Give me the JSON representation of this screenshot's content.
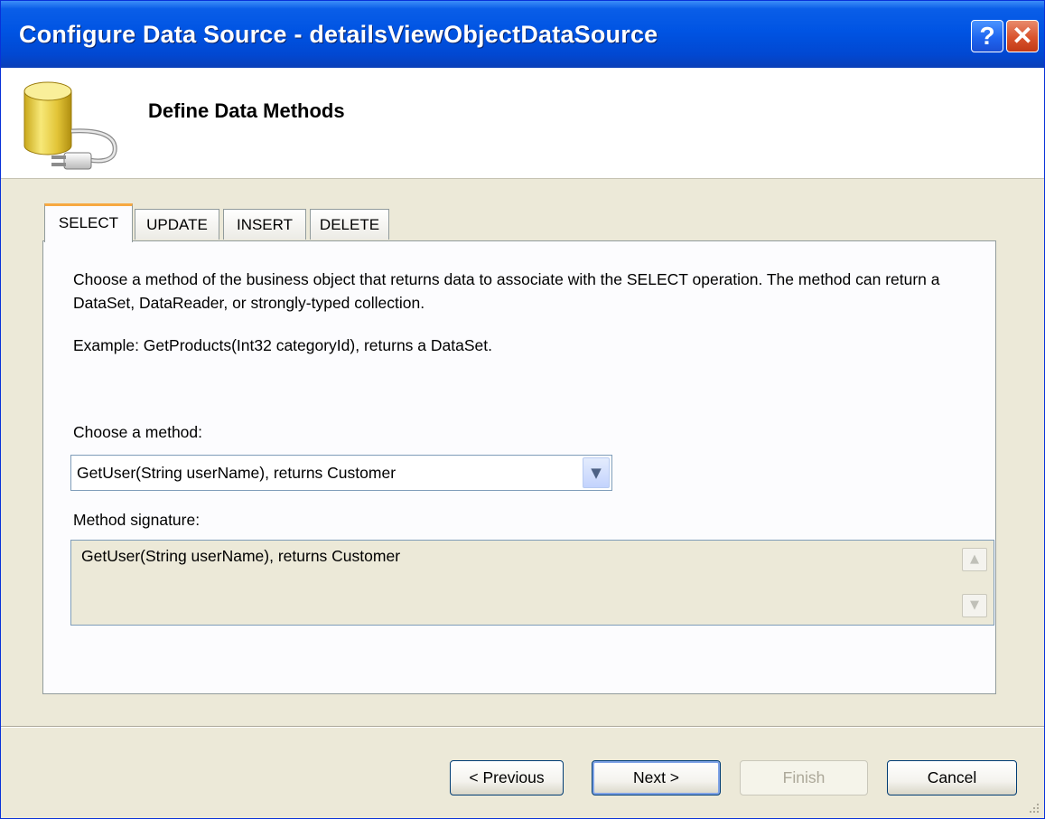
{
  "window": {
    "title": "Configure Data Source - detailsViewObjectDataSource",
    "help_label": "?",
    "close_label": "✕"
  },
  "header": {
    "title": "Define Data Methods",
    "icon": "database-connector-icon"
  },
  "tabs": [
    {
      "label": "SELECT",
      "active": true
    },
    {
      "label": "UPDATE",
      "active": false
    },
    {
      "label": "INSERT",
      "active": false
    },
    {
      "label": "DELETE",
      "active": false
    }
  ],
  "panel": {
    "description": "Choose a method of the business object that returns data to associate with the SELECT operation. The method can return a DataSet, DataReader, or strongly-typed collection.",
    "example": "Example: GetProducts(Int32 categoryId), returns a DataSet.",
    "choose_label": "Choose a method:",
    "selected_method": "GetUser(String userName), returns Customer",
    "signature_label": "Method signature:",
    "signature_value": "GetUser(String userName), returns Customer"
  },
  "buttons": {
    "previous": "< Previous",
    "next": "Next >",
    "finish": "Finish",
    "cancel": "Cancel"
  },
  "colors": {
    "titlebar": "#0054e3",
    "dialog_bg": "#ece9d8",
    "active_tab_accent": "#f7a941"
  }
}
